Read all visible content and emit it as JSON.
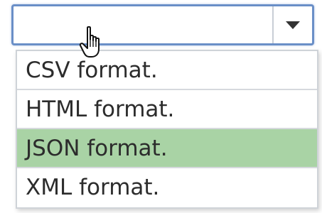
{
  "select": {
    "value": "",
    "arrow_icon": "chevron-down-icon"
  },
  "cursor": {
    "icon": "hand-pointer-icon"
  },
  "dropdown": {
    "options": [
      {
        "label": "CSV format.",
        "selected": false
      },
      {
        "label": "HTML format.",
        "selected": false
      },
      {
        "label": "JSON format.",
        "selected": true
      },
      {
        "label": "XML format.",
        "selected": false
      }
    ],
    "highlight_color": "#a9d3a5",
    "focus_border_color": "#6a8fc7"
  }
}
